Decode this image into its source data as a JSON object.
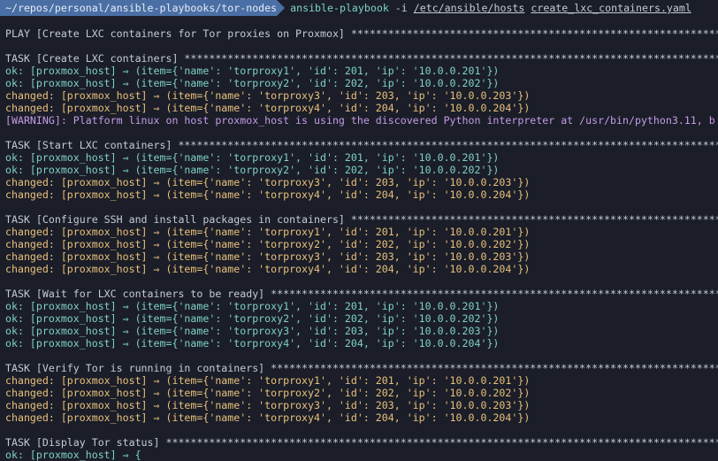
{
  "prompt": {
    "path": "~/repos/personal/ansible-playbooks/tor-nodes",
    "command": "ansible-playbook",
    "flag": "-i",
    "inventory": "/etc/ansible/hosts",
    "playbook": "create_lxc_containers.yaml"
  },
  "colors": {
    "background": "#1b1e28",
    "prompt_bg": "#4a6fa5",
    "ok": "#7fd1c7",
    "changed": "#e8c07d",
    "warning": "#c59be8",
    "header": "#c5cbd6"
  },
  "lines": [
    {
      "text": "PLAY [Create LXC containers for Tor proxies on Proxmox] **************************************************************************",
      "kind": "header"
    },
    {
      "text": "TASK [Create LXC containers] ****************************************************************************************************",
      "kind": "header"
    },
    {
      "text": "ok: [proxmox_host] ⇒ (item={'name': 'torproxy1', 'id': 201, 'ip': '10.0.0.201'})",
      "kind": "ok"
    },
    {
      "text": "ok: [proxmox_host] ⇒ (item={'name': 'torproxy2', 'id': 202, 'ip': '10.0.0.202'})",
      "kind": "ok"
    },
    {
      "text": "changed: [proxmox_host] ⇒ (item={'name': 'torproxy3', 'id': 203, 'ip': '10.0.0.203'})",
      "kind": "changed"
    },
    {
      "text": "changed: [proxmox_host] ⇒ (item={'name': 'torproxy4', 'id': 204, 'ip': '10.0.0.204'})",
      "kind": "changed"
    },
    {
      "text": "[WARNING]: Platform linux on host proxmox_host is using the discovered Python interpreter at /usr/bin/python3.11, b",
      "kind": "warning"
    },
    {
      "text": "TASK [Start LXC containers] *****************************************************************************************************",
      "kind": "header"
    },
    {
      "text": "ok: [proxmox_host] ⇒ (item={'name': 'torproxy1', 'id': 201, 'ip': '10.0.0.201'})",
      "kind": "ok"
    },
    {
      "text": "ok: [proxmox_host] ⇒ (item={'name': 'torproxy2', 'id': 202, 'ip': '10.0.0.202'})",
      "kind": "ok"
    },
    {
      "text": "changed: [proxmox_host] ⇒ (item={'name': 'torproxy3', 'id': 203, 'ip': '10.0.0.203'})",
      "kind": "changed"
    },
    {
      "text": "changed: [proxmox_host] ⇒ (item={'name': 'torproxy4', 'id': 204, 'ip': '10.0.0.204'})",
      "kind": "changed"
    },
    {
      "text": "TASK [Configure SSH and install packages in containers] **************************************************************************",
      "kind": "header"
    },
    {
      "text": "changed: [proxmox_host] ⇒ (item={'name': 'torproxy1', 'id': 201, 'ip': '10.0.0.201'})",
      "kind": "changed"
    },
    {
      "text": "changed: [proxmox_host] ⇒ (item={'name': 'torproxy2', 'id': 202, 'ip': '10.0.0.202'})",
      "kind": "changed"
    },
    {
      "text": "changed: [proxmox_host] ⇒ (item={'name': 'torproxy3', 'id': 203, 'ip': '10.0.0.203'})",
      "kind": "changed"
    },
    {
      "text": "changed: [proxmox_host] ⇒ (item={'name': 'torproxy4', 'id': 204, 'ip': '10.0.0.204'})",
      "kind": "changed"
    },
    {
      "text": "TASK [Wait for LXC containers to be ready] ******************************************************************************************",
      "kind": "header"
    },
    {
      "text": "ok: [proxmox_host] ⇒ (item={'name': 'torproxy1', 'id': 201, 'ip': '10.0.0.201'})",
      "kind": "ok"
    },
    {
      "text": "ok: [proxmox_host] ⇒ (item={'name': 'torproxy2', 'id': 202, 'ip': '10.0.0.202'})",
      "kind": "ok"
    },
    {
      "text": "ok: [proxmox_host] ⇒ (item={'name': 'torproxy3', 'id': 203, 'ip': '10.0.0.203'})",
      "kind": "ok"
    },
    {
      "text": "ok: [proxmox_host] ⇒ (item={'name': 'torproxy4', 'id': 204, 'ip': '10.0.0.204'})",
      "kind": "ok"
    },
    {
      "text": "TASK [Verify Tor is running in containers] *****************************************************************************************",
      "kind": "header"
    },
    {
      "text": "changed: [proxmox_host] ⇒ (item={'name': 'torproxy1', 'id': 201, 'ip': '10.0.0.201'})",
      "kind": "changed"
    },
    {
      "text": "changed: [proxmox_host] ⇒ (item={'name': 'torproxy2', 'id': 202, 'ip': '10.0.0.202'})",
      "kind": "changed"
    },
    {
      "text": "changed: [proxmox_host] ⇒ (item={'name': 'torproxy3', 'id': 203, 'ip': '10.0.0.203'})",
      "kind": "changed"
    },
    {
      "text": "changed: [proxmox_host] ⇒ (item={'name': 'torproxy4', 'id': 204, 'ip': '10.0.0.204'})",
      "kind": "changed"
    },
    {
      "text": "TASK [Display Tor status] ***********************************************************************************************************",
      "kind": "header"
    },
    {
      "text": "ok: [proxmox_host] ⇒ {",
      "kind": "ok"
    }
  ]
}
